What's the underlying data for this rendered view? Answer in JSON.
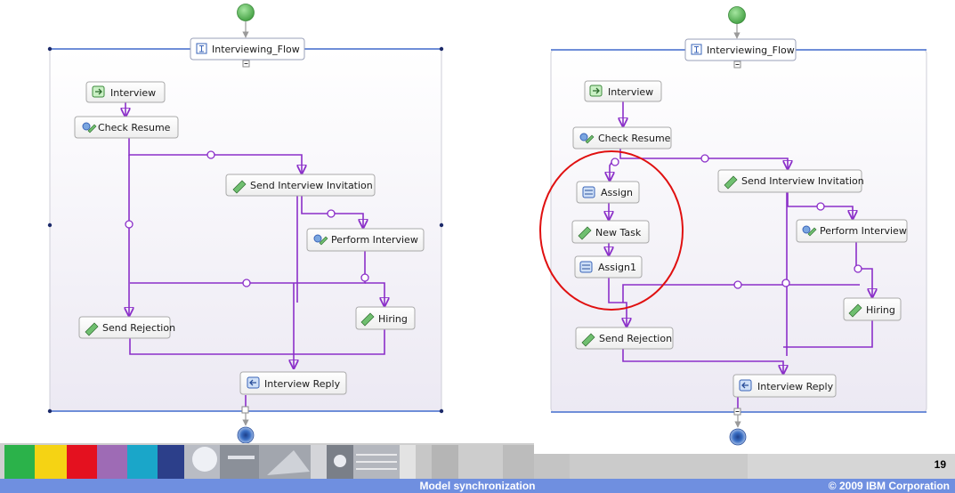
{
  "colors": {
    "flow_line": "#8b2fc9",
    "start_node": "#5db85d",
    "end_node": "#3a6fc4",
    "highlight_circle": "#e01010",
    "footer_bar": "#6f8fe0"
  },
  "left_diagram": {
    "flow_title": "Interviewing_Flow",
    "nodes": {
      "interview": "Interview",
      "check_resume": "Check Resume",
      "send_invitation": "Send Interview Invitation",
      "perform_interview": "Perform Interview",
      "send_rejection": "Send Rejection",
      "hiring": "Hiring",
      "interview_reply": "Interview Reply"
    }
  },
  "right_diagram": {
    "flow_title": "Interviewing_Flow",
    "nodes": {
      "interview": "Interview",
      "check_resume": "Check Resume",
      "assign": "Assign",
      "new_task": "New Task",
      "assign1": "Assign1",
      "send_invitation": "Send Interview Invitation",
      "perform_interview": "Perform Interview",
      "hiring": "Hiring",
      "send_rejection": "Send Rejection",
      "interview_reply": "Interview Reply"
    }
  },
  "footer": {
    "title": "Model synchronization",
    "copyright": "© 2009 IBM Corporation",
    "page_number": "19"
  }
}
